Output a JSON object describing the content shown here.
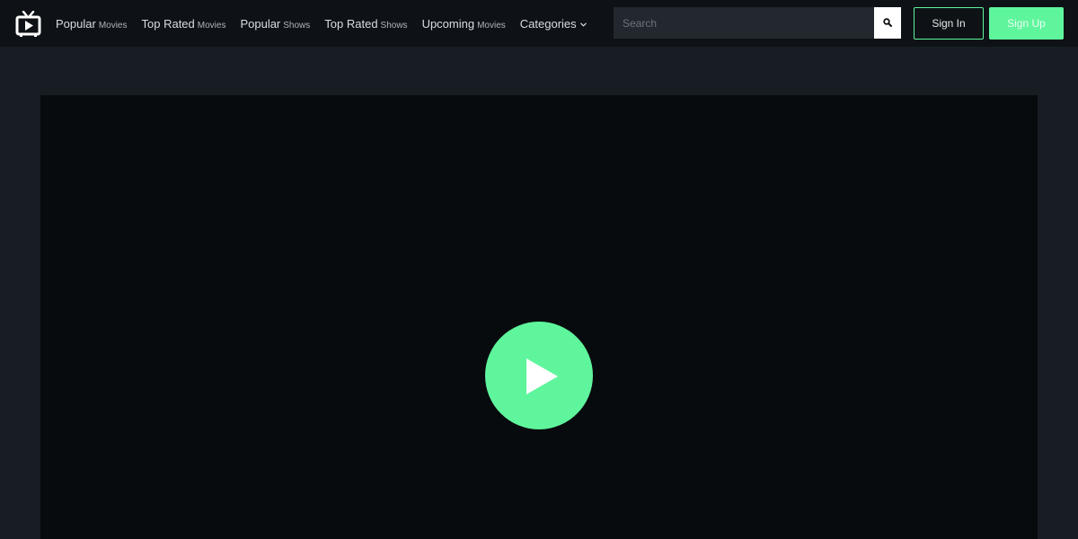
{
  "brand": {
    "logo_icon": "tv-play-icon"
  },
  "nav": {
    "items": [
      {
        "main": "Popular",
        "sub": "Movies"
      },
      {
        "main": "Top Rated",
        "sub": "Movies"
      },
      {
        "main": "Popular",
        "sub": "Shows"
      },
      {
        "main": "Top Rated",
        "sub": "Shows"
      },
      {
        "main": "Upcoming",
        "sub": "Movies"
      }
    ],
    "categories_label": "Categories",
    "categories_icon": "chevron-down-icon"
  },
  "search": {
    "placeholder": "Search",
    "value": "",
    "icon": "search-icon"
  },
  "auth": {
    "signin_label": "Sign In",
    "signup_label": "Sign Up"
  },
  "player": {
    "play_icon": "play-icon"
  },
  "colors": {
    "accent": "#5ff59c",
    "navbar_bg": "#0e1216",
    "page_bg": "#171d23",
    "player_bg": "#080b0e"
  }
}
